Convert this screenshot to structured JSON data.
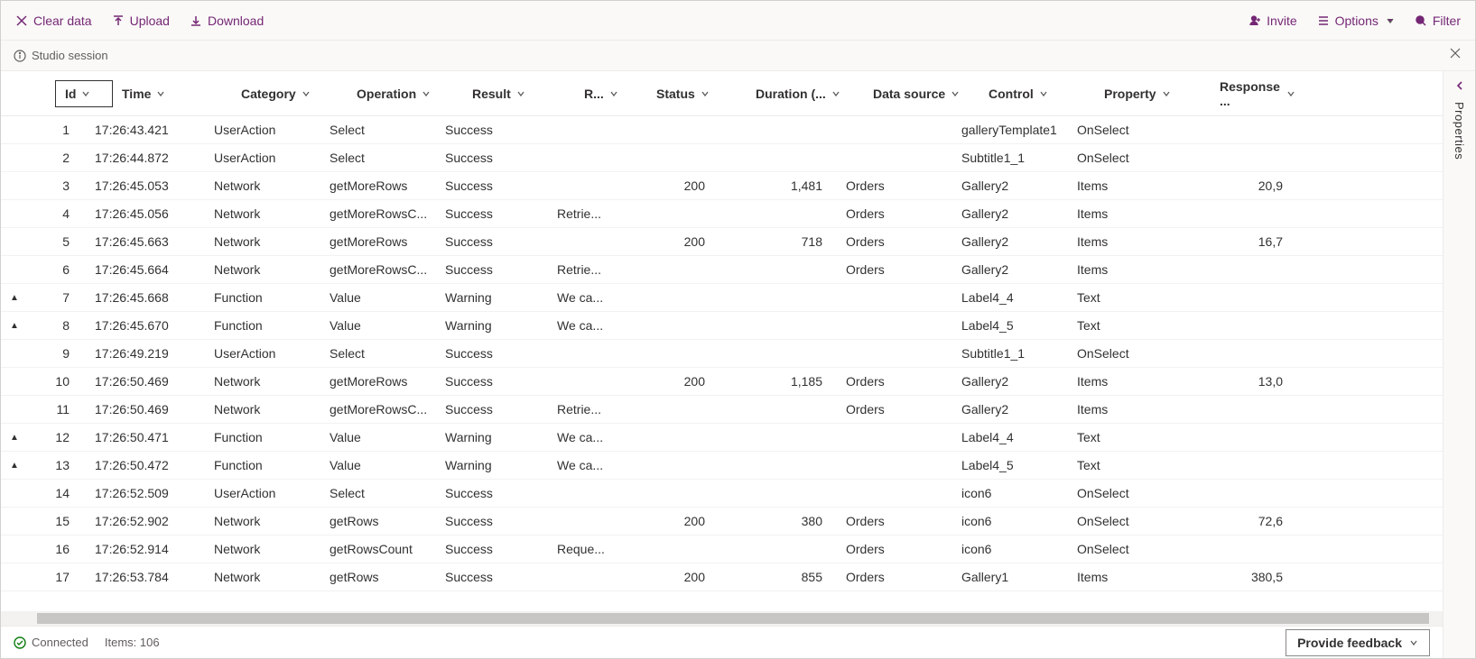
{
  "toolbar": {
    "clear": "Clear data",
    "upload": "Upload",
    "download": "Download",
    "invite": "Invite",
    "options": "Options",
    "filter": "Filter"
  },
  "session": {
    "label": "Studio session"
  },
  "columns": {
    "id": "Id",
    "time": "Time",
    "category": "Category",
    "operation": "Operation",
    "result": "Result",
    "r": "R...",
    "status": "Status",
    "duration": "Duration (...",
    "datasource": "Data source",
    "control": "Control",
    "property": "Property",
    "response": "Response ..."
  },
  "rows": [
    {
      "warn": "",
      "id": "1",
      "time": "17:26:43.421",
      "cat": "UserAction",
      "op": "Select",
      "res": "Success",
      "r": "",
      "stat": "",
      "dur": "",
      "ds": "",
      "ctl": "galleryTemplate1",
      "prop": "OnSelect",
      "resp": ""
    },
    {
      "warn": "",
      "id": "2",
      "time": "17:26:44.872",
      "cat": "UserAction",
      "op": "Select",
      "res": "Success",
      "r": "",
      "stat": "",
      "dur": "",
      "ds": "",
      "ctl": "Subtitle1_1",
      "prop": "OnSelect",
      "resp": ""
    },
    {
      "warn": "",
      "id": "3",
      "time": "17:26:45.053",
      "cat": "Network",
      "op": "getMoreRows",
      "res": "Success",
      "r": "",
      "stat": "200",
      "dur": "1,481",
      "ds": "Orders",
      "ctl": "Gallery2",
      "prop": "Items",
      "resp": "20,9"
    },
    {
      "warn": "",
      "id": "4",
      "time": "17:26:45.056",
      "cat": "Network",
      "op": "getMoreRowsC...",
      "res": "Success",
      "r": "Retrie...",
      "stat": "",
      "dur": "",
      "ds": "Orders",
      "ctl": "Gallery2",
      "prop": "Items",
      "resp": ""
    },
    {
      "warn": "",
      "id": "5",
      "time": "17:26:45.663",
      "cat": "Network",
      "op": "getMoreRows",
      "res": "Success",
      "r": "",
      "stat": "200",
      "dur": "718",
      "ds": "Orders",
      "ctl": "Gallery2",
      "prop": "Items",
      "resp": "16,7"
    },
    {
      "warn": "",
      "id": "6",
      "time": "17:26:45.664",
      "cat": "Network",
      "op": "getMoreRowsC...",
      "res": "Success",
      "r": "Retrie...",
      "stat": "",
      "dur": "",
      "ds": "Orders",
      "ctl": "Gallery2",
      "prop": "Items",
      "resp": ""
    },
    {
      "warn": "▲",
      "id": "7",
      "time": "17:26:45.668",
      "cat": "Function",
      "op": "Value",
      "res": "Warning",
      "r": "We ca...",
      "stat": "",
      "dur": "",
      "ds": "",
      "ctl": "Label4_4",
      "prop": "Text",
      "resp": ""
    },
    {
      "warn": "▲",
      "id": "8",
      "time": "17:26:45.670",
      "cat": "Function",
      "op": "Value",
      "res": "Warning",
      "r": "We ca...",
      "stat": "",
      "dur": "",
      "ds": "",
      "ctl": "Label4_5",
      "prop": "Text",
      "resp": ""
    },
    {
      "warn": "",
      "id": "9",
      "time": "17:26:49.219",
      "cat": "UserAction",
      "op": "Select",
      "res": "Success",
      "r": "",
      "stat": "",
      "dur": "",
      "ds": "",
      "ctl": "Subtitle1_1",
      "prop": "OnSelect",
      "resp": ""
    },
    {
      "warn": "",
      "id": "10",
      "time": "17:26:50.469",
      "cat": "Network",
      "op": "getMoreRows",
      "res": "Success",
      "r": "",
      "stat": "200",
      "dur": "1,185",
      "ds": "Orders",
      "ctl": "Gallery2",
      "prop": "Items",
      "resp": "13,0"
    },
    {
      "warn": "",
      "id": "11",
      "time": "17:26:50.469",
      "cat": "Network",
      "op": "getMoreRowsC...",
      "res": "Success",
      "r": "Retrie...",
      "stat": "",
      "dur": "",
      "ds": "Orders",
      "ctl": "Gallery2",
      "prop": "Items",
      "resp": ""
    },
    {
      "warn": "▲",
      "id": "12",
      "time": "17:26:50.471",
      "cat": "Function",
      "op": "Value",
      "res": "Warning",
      "r": "We ca...",
      "stat": "",
      "dur": "",
      "ds": "",
      "ctl": "Label4_4",
      "prop": "Text",
      "resp": ""
    },
    {
      "warn": "▲",
      "id": "13",
      "time": "17:26:50.472",
      "cat": "Function",
      "op": "Value",
      "res": "Warning",
      "r": "We ca...",
      "stat": "",
      "dur": "",
      "ds": "",
      "ctl": "Label4_5",
      "prop": "Text",
      "resp": ""
    },
    {
      "warn": "",
      "id": "14",
      "time": "17:26:52.509",
      "cat": "UserAction",
      "op": "Select",
      "res": "Success",
      "r": "",
      "stat": "",
      "dur": "",
      "ds": "",
      "ctl": "icon6",
      "prop": "OnSelect",
      "resp": ""
    },
    {
      "warn": "",
      "id": "15",
      "time": "17:26:52.902",
      "cat": "Network",
      "op": "getRows",
      "res": "Success",
      "r": "",
      "stat": "200",
      "dur": "380",
      "ds": "Orders",
      "ctl": "icon6",
      "prop": "OnSelect",
      "resp": "72,6"
    },
    {
      "warn": "",
      "id": "16",
      "time": "17:26:52.914",
      "cat": "Network",
      "op": "getRowsCount",
      "res": "Success",
      "r": "Reque...",
      "stat": "",
      "dur": "",
      "ds": "Orders",
      "ctl": "icon6",
      "prop": "OnSelect",
      "resp": ""
    },
    {
      "warn": "",
      "id": "17",
      "time": "17:26:53.784",
      "cat": "Network",
      "op": "getRows",
      "res": "Success",
      "r": "",
      "stat": "200",
      "dur": "855",
      "ds": "Orders",
      "ctl": "Gallery1",
      "prop": "Items",
      "resp": "380,5"
    }
  ],
  "status": {
    "connected": "Connected",
    "items": "Items: 106",
    "feedback": "Provide feedback"
  },
  "panel": {
    "properties": "Properties"
  }
}
